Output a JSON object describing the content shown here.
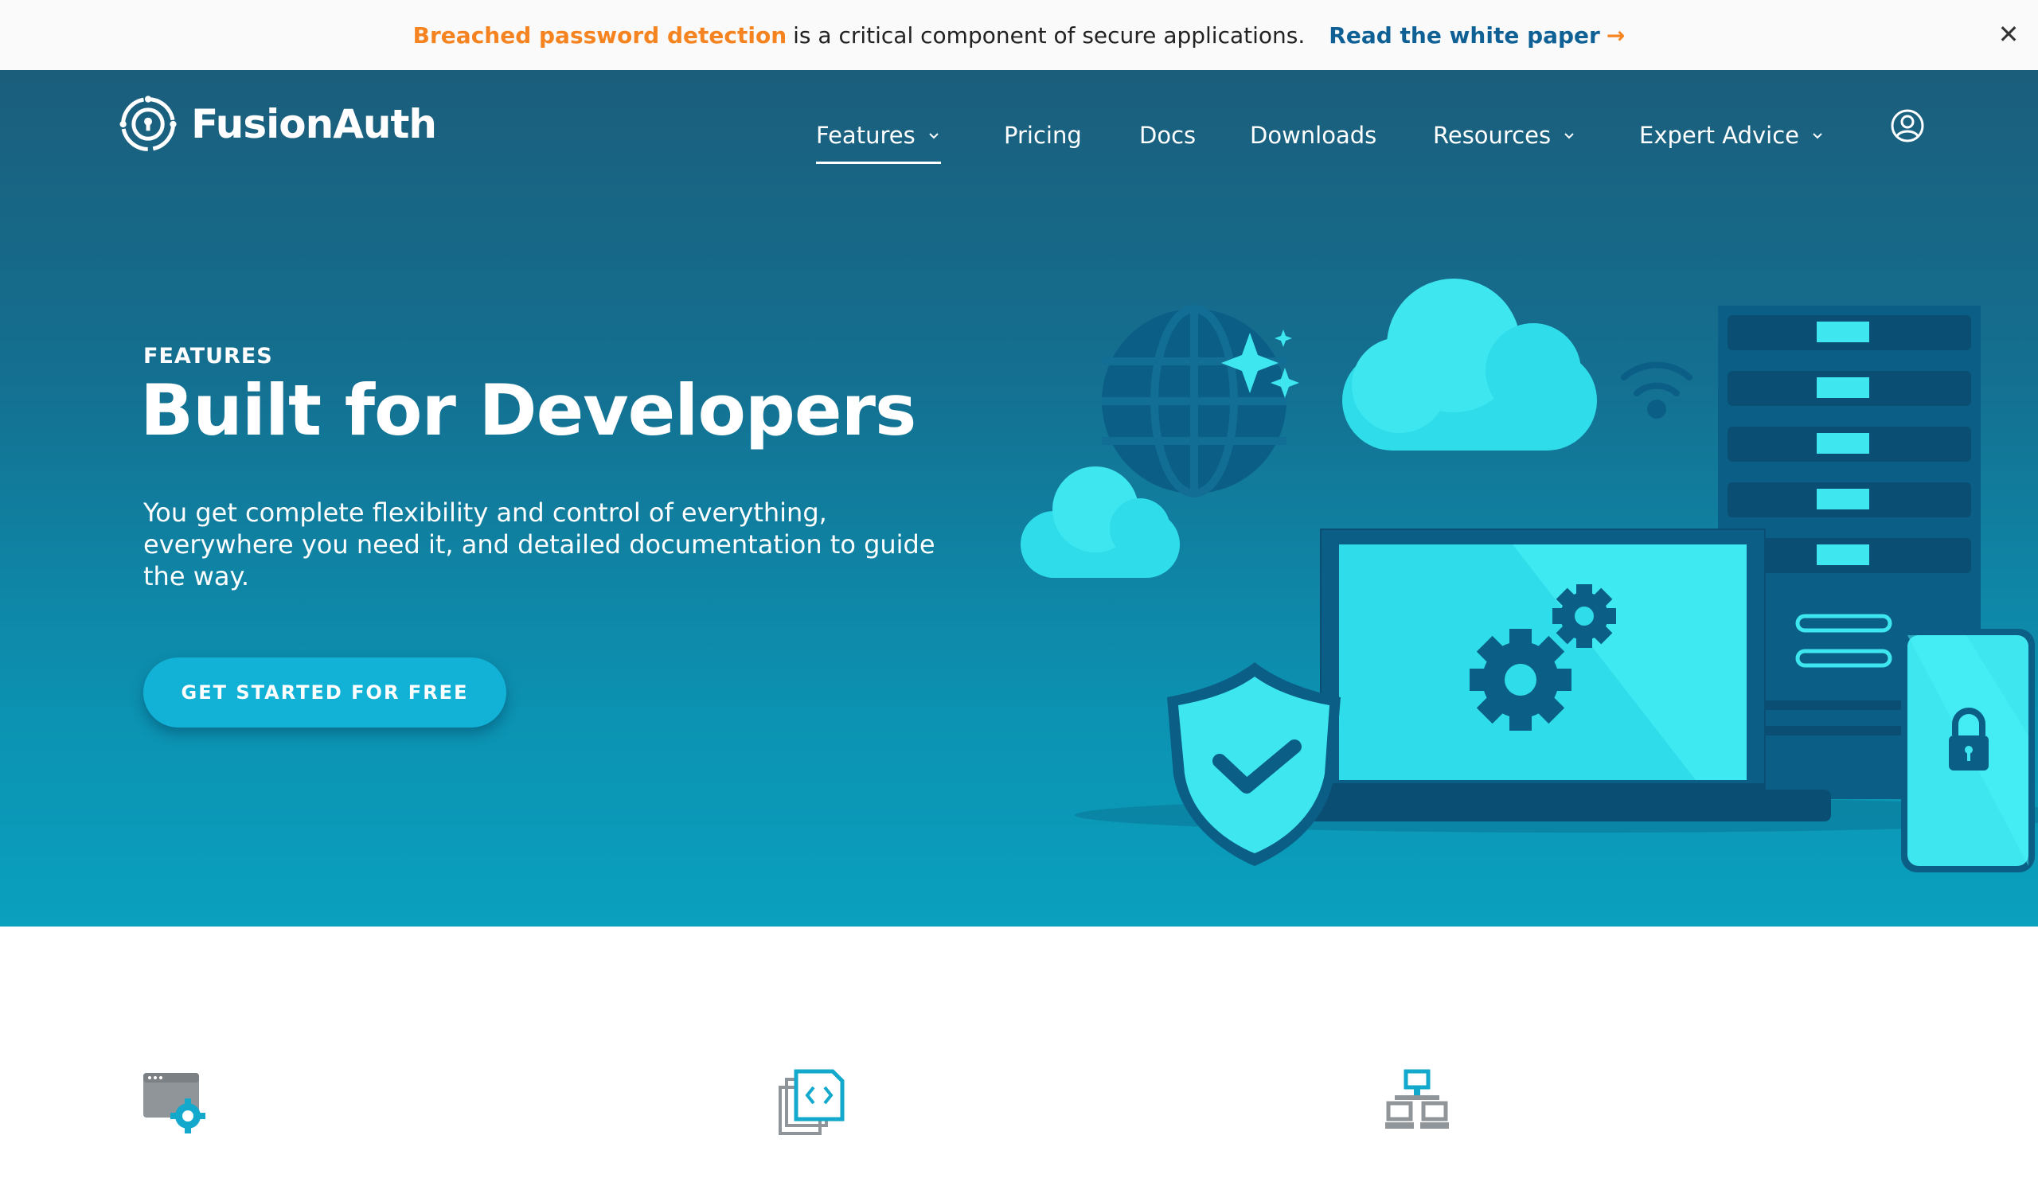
{
  "announcement": {
    "highlight": "Breached password detection",
    "message": "is a critical component of secure applications.",
    "link_label": "Read the white paper",
    "link_arrow": "→",
    "close_label": "✕"
  },
  "brand": {
    "name": "FusionAuth",
    "logo_icon": "fusionauth-logo-icon"
  },
  "nav": {
    "items": [
      {
        "label": "Features",
        "has_dropdown": true,
        "active": true
      },
      {
        "label": "Pricing",
        "has_dropdown": false
      },
      {
        "label": "Docs",
        "has_dropdown": false
      },
      {
        "label": "Downloads",
        "has_dropdown": false
      },
      {
        "label": "Resources",
        "has_dropdown": true
      },
      {
        "label": "Expert Advice",
        "has_dropdown": true
      }
    ],
    "account_icon": "user-circle-icon"
  },
  "hero": {
    "eyebrow": "FEATURES",
    "title": "Built for Developers",
    "description": "You get complete flexibility and control of everything, everywhere you need it, and detailed documentation to guide the way.",
    "cta_label": "GET STARTED FOR FREE",
    "illustration": "developer-infrastructure-illustration"
  },
  "features": {
    "icons": [
      "browser-gear-icon",
      "code-document-icon",
      "network-computers-icon"
    ]
  },
  "colors": {
    "accent_orange": "#f58320",
    "link_blue": "#0f6195",
    "hero_top": "#1b5e7c",
    "hero_bottom": "#0aa0be",
    "cta": "#12b2d6",
    "cyan": "#3ee6f0"
  }
}
